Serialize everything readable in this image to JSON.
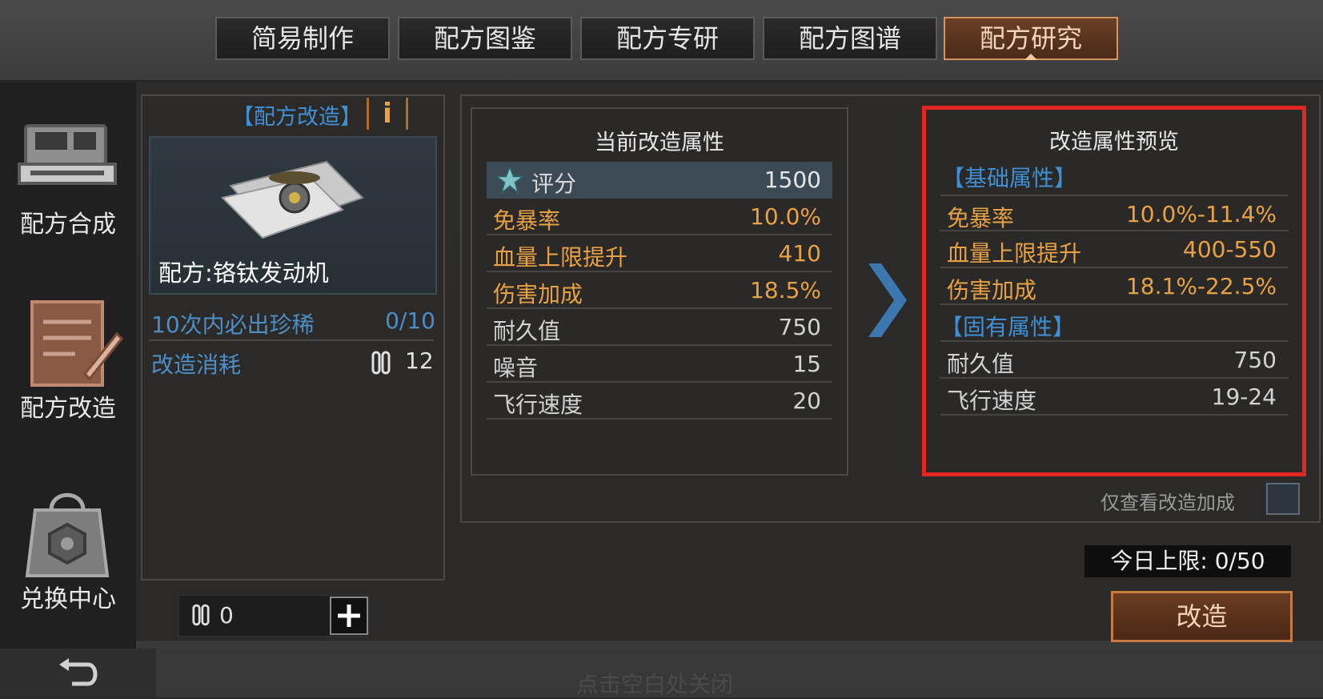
{
  "tabs": [
    {
      "label": "简易制作",
      "active": false
    },
    {
      "label": "配方图鉴",
      "active": false
    },
    {
      "label": "配方专研",
      "active": false
    },
    {
      "label": "配方图谱",
      "active": false
    },
    {
      "label": "配方研究",
      "active": true
    }
  ],
  "sidebar": {
    "items": [
      {
        "label": "配方合成",
        "icon": "printer-icon"
      },
      {
        "label": "配方改造",
        "icon": "blueprint-edit-icon"
      },
      {
        "label": "兑换中心",
        "icon": "shopping-bag-icon"
      }
    ]
  },
  "recipe": {
    "section_title": "【配方改造】",
    "info_icon": "i",
    "item_name": "配方:铬钛发动机",
    "guarantee_label": "10次内必出珍稀",
    "guarantee_value": "0/10",
    "cost_label": "改造消耗",
    "cost_value": "12",
    "owned_value": "0"
  },
  "current": {
    "title": "当前改造属性",
    "rows": [
      {
        "k": "评分",
        "v": "1500",
        "style": "hl"
      },
      {
        "k": "免暴率",
        "v": "10.0%",
        "style": "gold"
      },
      {
        "k": "血量上限提升",
        "v": "410",
        "style": "gold"
      },
      {
        "k": "伤害加成",
        "v": "18.5%",
        "style": "gold"
      },
      {
        "k": "耐久值",
        "v": "750",
        "style": "grey"
      },
      {
        "k": "噪音",
        "v": "15",
        "style": "grey"
      },
      {
        "k": "飞行速度",
        "v": "20",
        "style": "grey"
      }
    ]
  },
  "preview": {
    "title": "改造属性预览",
    "base_label": "【基础属性】",
    "base_rows": [
      {
        "k": "免暴率",
        "v": "10.0%-11.4%"
      },
      {
        "k": "血量上限提升",
        "v": "400-550"
      },
      {
        "k": "伤害加成",
        "v": "18.1%-22.5%"
      }
    ],
    "fixed_label": "【固有属性】",
    "fixed_rows": [
      {
        "k": "耐久值",
        "v": "750"
      },
      {
        "k": "飞行速度",
        "v": "19-24"
      }
    ]
  },
  "filter": {
    "label": "仅查看改造加成"
  },
  "daily_limit": {
    "label": "今日上限: 0/50"
  },
  "forge_button": {
    "label": "改造"
  },
  "close_hint": "点击空白处关闭",
  "colors": {
    "accent": "#d7935b",
    "gold": "#e8a245",
    "blue": "#3f8fd4",
    "highlight": "#e3261f"
  }
}
